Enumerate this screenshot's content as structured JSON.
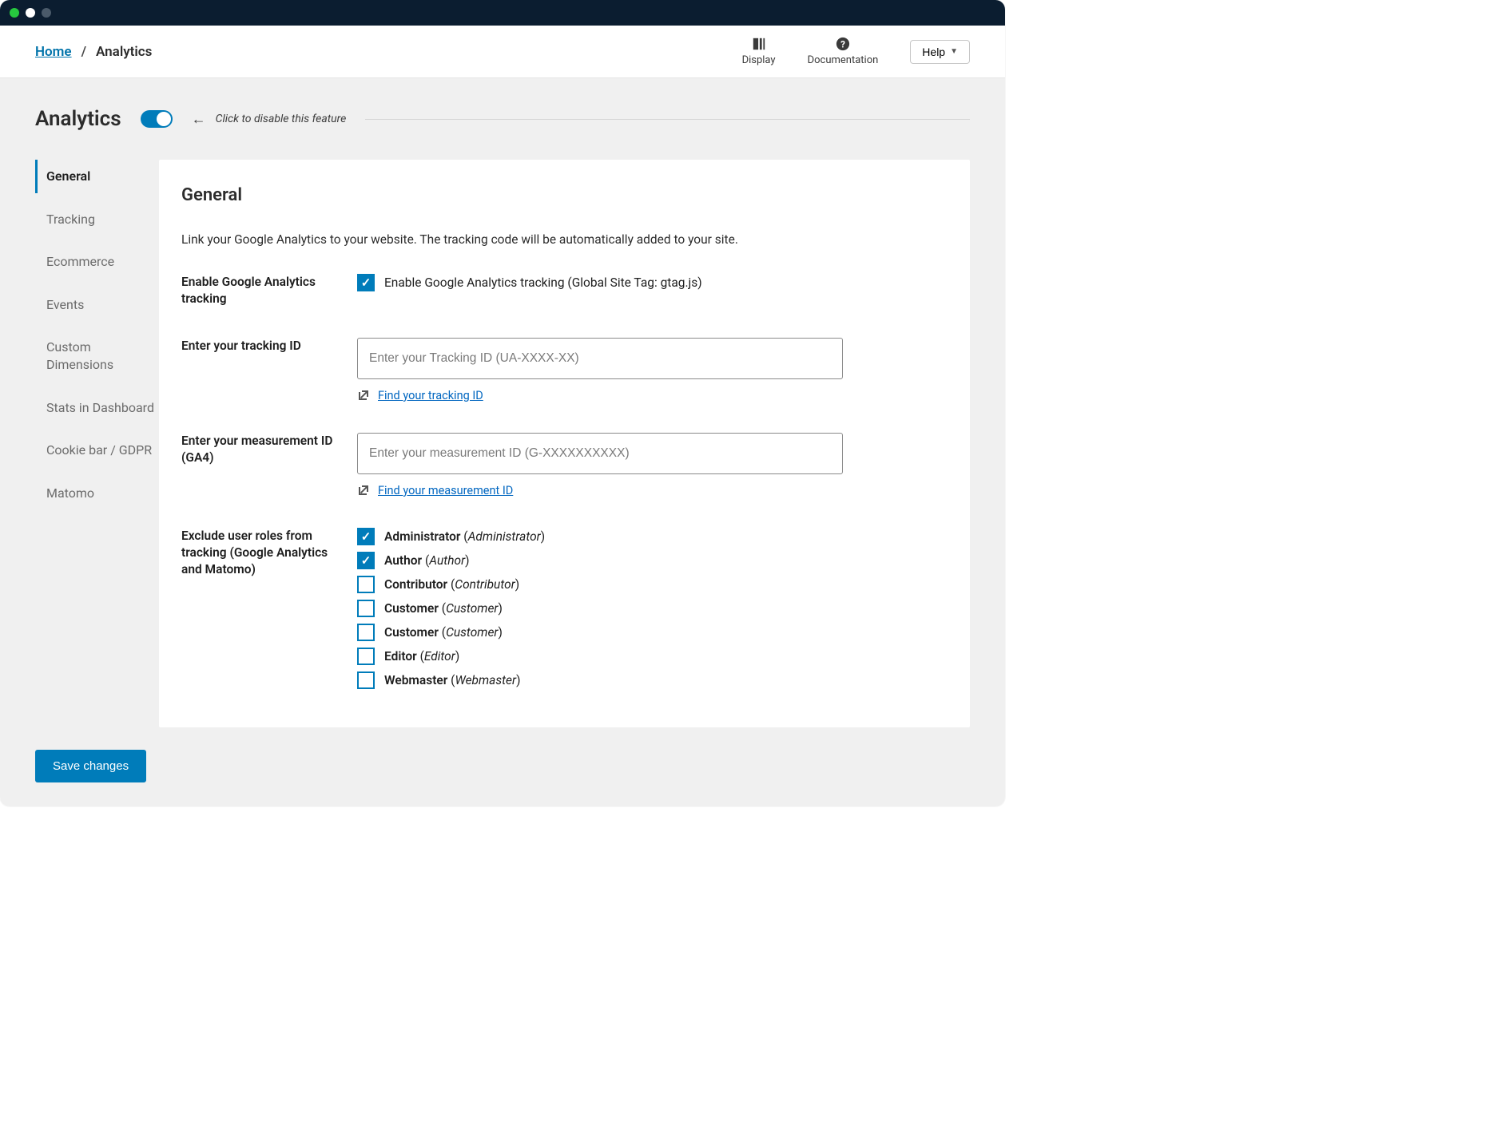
{
  "breadcrumb": {
    "home": "Home",
    "sep": "/",
    "current": "Analytics"
  },
  "topbar": {
    "display": "Display",
    "documentation": "Documentation",
    "help": "Help"
  },
  "page": {
    "title": "Analytics",
    "toggle_hint": "Click to disable this feature"
  },
  "tabs": [
    "General",
    "Tracking",
    "Ecommerce",
    "Events",
    "Custom Dimensions",
    "Stats in Dashboard",
    "Cookie bar / GDPR",
    "Matomo"
  ],
  "panel": {
    "heading": "General",
    "description": "Link your Google Analytics to your website. The tracking code will be automatically added to your site."
  },
  "form": {
    "enable_label": "Enable Google Analytics tracking",
    "enable_checkbox": "Enable Google Analytics tracking (Global Site Tag: gtag.js)",
    "tracking_id_label": "Enter your tracking ID",
    "tracking_id_placeholder": "Enter your Tracking ID (UA-XXXX-XX)",
    "tracking_id_link": "Find your tracking ID",
    "measurement_id_label": "Enter your measurement ID (GA4)",
    "measurement_id_placeholder": "Enter your measurement ID (G-XXXXXXXXXX)",
    "measurement_id_link": "Find your measurement ID",
    "exclude_label": "Exclude user roles from tracking (Google Analytics and Matomo)",
    "roles": [
      {
        "name": "Administrator",
        "slug": "Administrator",
        "checked": true
      },
      {
        "name": "Author",
        "slug": "Author",
        "checked": true
      },
      {
        "name": "Contributor",
        "slug": "Contributor",
        "checked": false
      },
      {
        "name": "Customer",
        "slug": "Customer",
        "checked": false
      },
      {
        "name": "Customer",
        "slug": "Customer",
        "checked": false
      },
      {
        "name": "Editor",
        "slug": "Editor",
        "checked": false
      },
      {
        "name": "Webmaster",
        "slug": "Webmaster",
        "checked": false
      }
    ]
  },
  "save_button": "Save changes"
}
